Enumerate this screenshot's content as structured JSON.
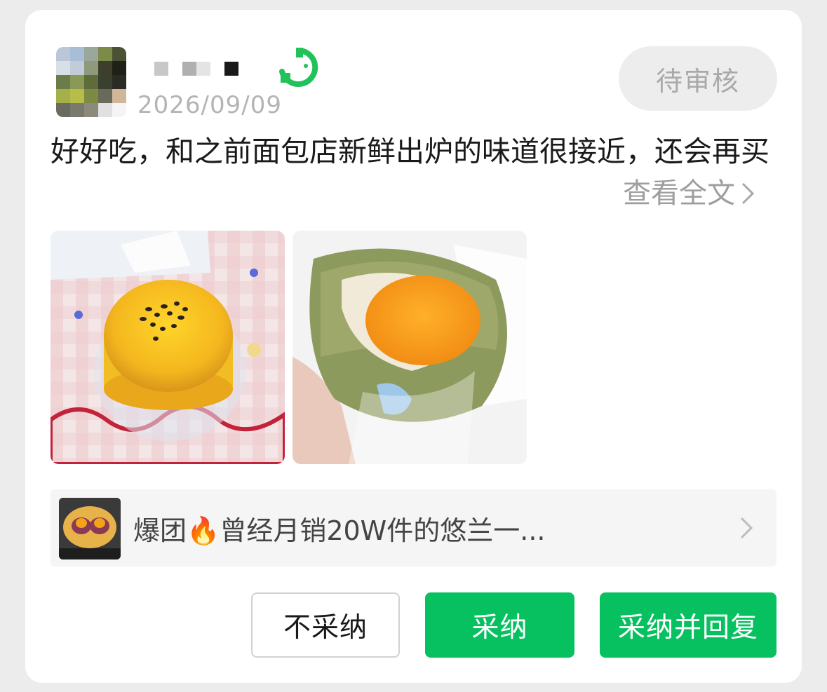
{
  "review": {
    "date": "2026/09/09",
    "status": "待审核",
    "text": "好好吃，和之前面包店新鲜出炉的味道很接近，还会再买",
    "expand_label": "查看全文",
    "photos": [
      "custard-bun-photo",
      "salted-egg-mooncake-photo"
    ]
  },
  "product": {
    "title": "爆团🔥曾经月销20W件的悠兰一..."
  },
  "actions": {
    "reject_label": "不采纳",
    "accept_label": "采纳",
    "accept_reply_label": "采纳并回复"
  },
  "colors": {
    "accent": "#07c160",
    "status_bg": "#ededed",
    "status_text": "#a9a9a9"
  }
}
